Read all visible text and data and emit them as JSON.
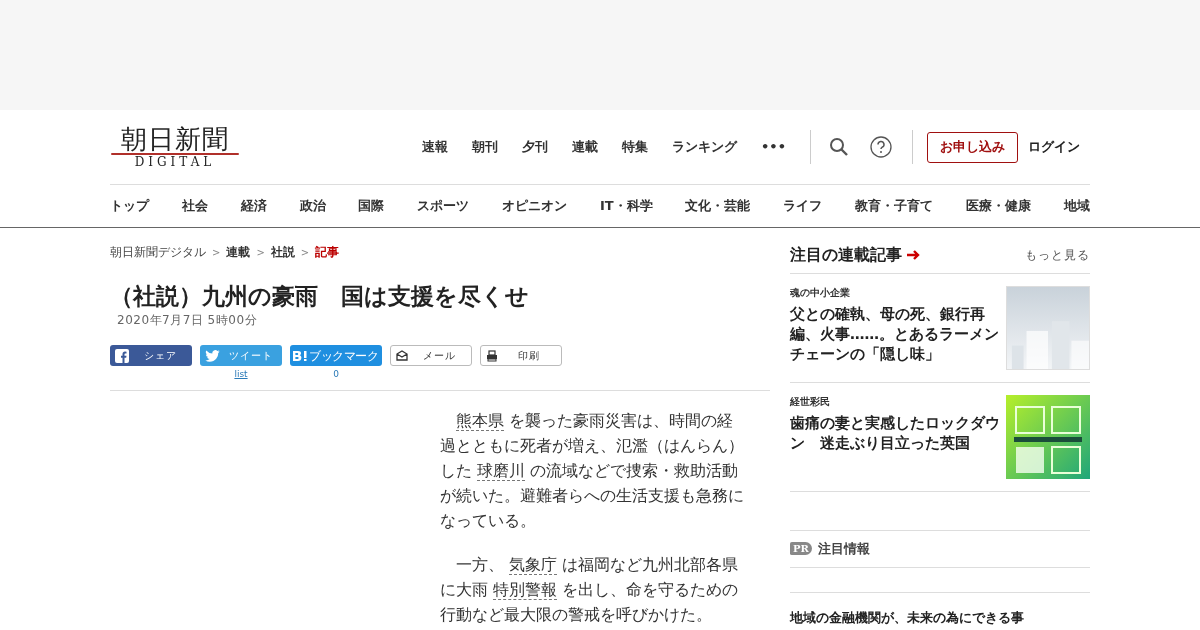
{
  "logo": {
    "name": "朝日新聞",
    "sub": "DIGITAL"
  },
  "top_nav": [
    "速報",
    "朝刊",
    "夕刊",
    "連載",
    "特集",
    "ランキング",
    "•••"
  ],
  "subscribe_button": "お申し込み",
  "login_link": "ログイン",
  "category_nav": [
    "トップ",
    "社会",
    "経済",
    "政治",
    "国際",
    "スポーツ",
    "オピニオン",
    "IT・科学",
    "文化・芸能",
    "ライフ",
    "教育・子育て",
    "医療・健康",
    "地域"
  ],
  "breadcrumb": [
    {
      "label": "朝日新聞デジタル",
      "kind": "site"
    },
    {
      "separator": ">",
      "label": "連載",
      "kind": "section"
    },
    {
      "separator": ">",
      "label": "社説",
      "kind": "section"
    },
    {
      "separator": ">",
      "label": "記事",
      "kind": "current"
    }
  ],
  "article": {
    "title": "（社説）九州の豪雨　国は支援を尽くせ",
    "date": "2020年7月7日 5時00分",
    "share_buttons": [
      {
        "kind": "facebook",
        "label": "シェア"
      },
      {
        "kind": "twitter",
        "label": "ツイート",
        "count": "list"
      },
      {
        "kind": "hatena",
        "label": "ブックマーク",
        "count": "0"
      },
      {
        "kind": "mail",
        "label": "メール"
      },
      {
        "kind": "print",
        "label": "印刷"
      }
    ],
    "paragraphs": [
      [
        {
          "kind": "term",
          "text": "熊本県"
        },
        {
          "kind": "text",
          "text": " を襲った豪雨災害は、時間の経過とともに死者が増え、氾濫（はんらん）した "
        },
        {
          "kind": "term",
          "text": "球磨川"
        },
        {
          "kind": "text",
          "text": " の流域などで捜索・救助活動が続いた。避難者らへの生活支援も急務になっている。"
        }
      ],
      [
        {
          "kind": "text",
          "text": "一方、 "
        },
        {
          "kind": "term",
          "text": "気象庁"
        },
        {
          "kind": "text",
          "text": " は福岡など九州北部各県に大雨 "
        },
        {
          "kind": "term",
          "text": "特別警報"
        },
        {
          "kind": "text",
          "text": " を出し、命を守るための行動など最大限の警戒を呼びかけた。"
        }
      ]
    ]
  },
  "sidebar": {
    "heading": "注目の連載記事",
    "more_link": "もっと見る",
    "items": [
      {
        "series": "魂の中小企業",
        "title": "父との確執、母の死、銀行再編、火事……。とあるラーメンチェーンの「隠し味」"
      },
      {
        "series": "経世彩民",
        "title": "歯痛の妻と実感したロックダウン　迷走ぶり目立った英国"
      }
    ],
    "pr_badge": "PR",
    "pr_heading": "注目情報",
    "pr_title": "地域の金融機関が、未来の為にできる事"
  }
}
